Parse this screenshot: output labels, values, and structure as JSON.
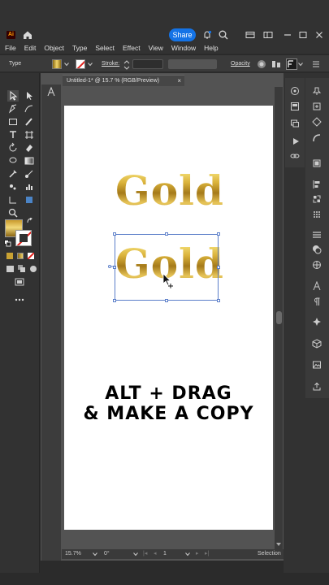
{
  "app": {
    "logo_text": "Ai",
    "share_label": "Share"
  },
  "menu": [
    "File",
    "Edit",
    "Object",
    "Type",
    "Select",
    "Effect",
    "View",
    "Window",
    "Help"
  ],
  "control_bar": {
    "type_label": "Type",
    "stroke_label": "Stroke:",
    "opacity_label": "Opacity"
  },
  "document": {
    "tab_title": "Untitled-1* @ 15.7 % (RGB/Preview)",
    "close_glyph": "×"
  },
  "artboard": {
    "word_top": "Gold",
    "word_bottom": "Gold",
    "caption_line1": "ALT + DRAG",
    "caption_line2": "& MAKE A COPY"
  },
  "status": {
    "zoom": "15.7%",
    "rotation": "0°",
    "artboard_num": "1",
    "mode": "Selection"
  },
  "colors": {
    "accent": "#1473e6",
    "selection": "#5b7ec9",
    "gold_light": "#f6e27a",
    "gold_dark": "#a57a1a"
  }
}
